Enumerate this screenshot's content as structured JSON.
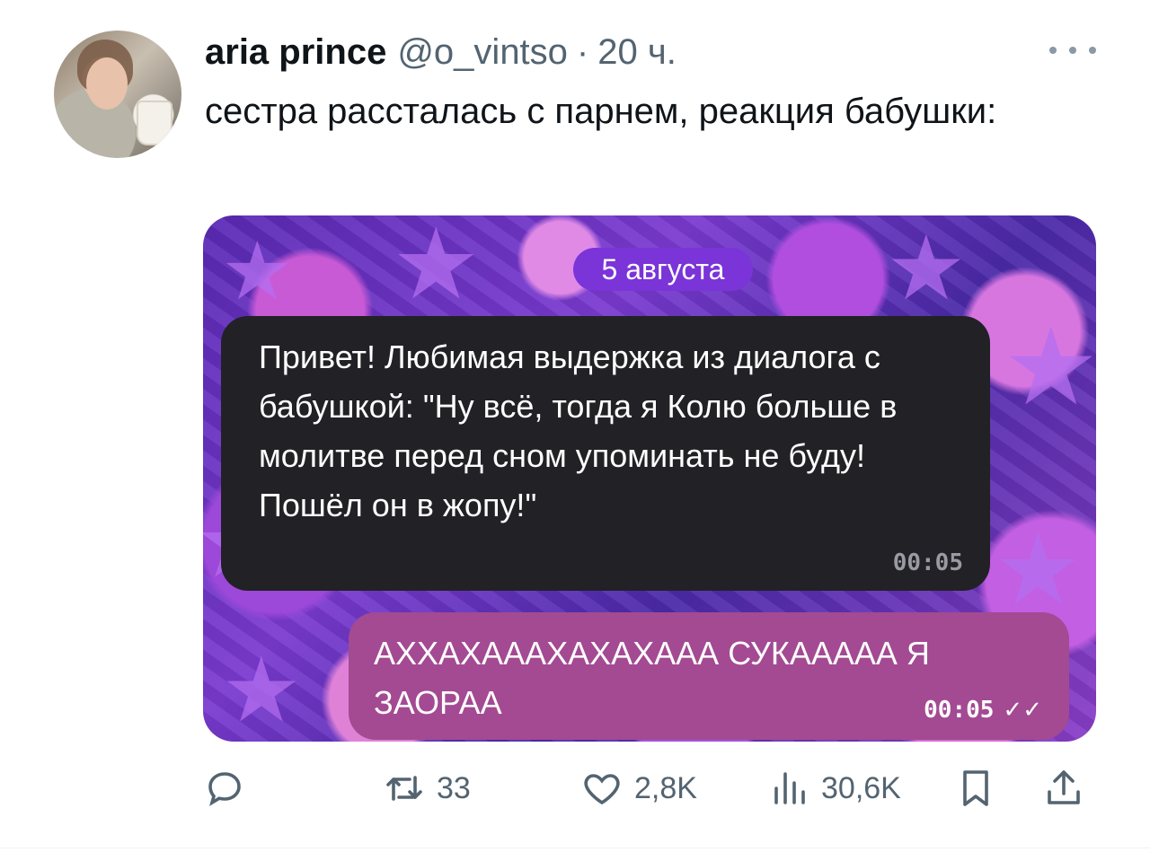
{
  "tweet": {
    "author_name": "aria prince",
    "handle": "@o_vintso",
    "separator": "·",
    "time": "20 ч.",
    "text": "сестра рассталась с парнем, реакция бабушки:",
    "more_icon": "more-horizontal-icon"
  },
  "media": {
    "date_pill": "5 августа",
    "incoming": {
      "text": "Привет! Любимая выдержка из диалога с бабушкой: \"Ну всё, тогда я Колю больше в молитве перед сном упоминать не буду! Пошёл он в жопу!\"",
      "time": "00:05"
    },
    "outgoing": {
      "text": "АХХАХАААХАХАХААА СУКААААА Я ЗАОРАА",
      "time": "00:05",
      "status_icon": "double-check-icon"
    }
  },
  "actions": {
    "reply": {
      "icon": "reply-icon",
      "count": ""
    },
    "retweet": {
      "icon": "retweet-icon",
      "count": "33"
    },
    "like": {
      "icon": "heart-icon",
      "count": "2,8K"
    },
    "views": {
      "icon": "views-icon",
      "count": "30,6K"
    },
    "bookmark": {
      "icon": "bookmark-icon"
    },
    "share": {
      "icon": "share-icon"
    }
  },
  "colors": {
    "text_primary": "#0f1419",
    "text_secondary": "#536471",
    "incoming_bubble": "#222126",
    "outgoing_bubble": "#a34a93",
    "date_pill": "#7a34d8"
  }
}
